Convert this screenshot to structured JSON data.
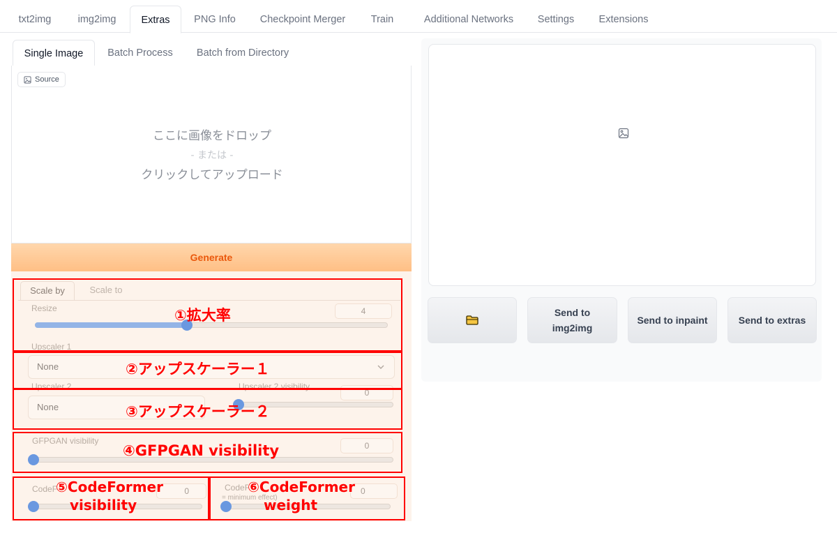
{
  "top_tabs": [
    "txt2img",
    "img2img",
    "Extras",
    "PNG Info",
    "Checkpoint Merger",
    "Train",
    "Additional Networks",
    "Settings",
    "Extensions"
  ],
  "sub_tabs": [
    "Single Image",
    "Batch Process",
    "Batch from Directory"
  ],
  "source_label": "Source",
  "dropzone": {
    "line1": "ここに画像をドロップ",
    "line2": "- または -",
    "line3": "クリックしてアップロード"
  },
  "generate_label": "Generate",
  "scale_tabs": [
    "Scale by",
    "Scale to"
  ],
  "resize": {
    "label": "Resize",
    "value": "4",
    "level": 0.43
  },
  "upscaler1": {
    "label": "Upscaler 1",
    "value": "None"
  },
  "upscaler2": {
    "label": "Upscaler 2",
    "value": "None"
  },
  "upscaler2_visibility": {
    "label": "Upscaler 2 visibility",
    "value": "0",
    "level": 0
  },
  "gfpgan": {
    "label": "GFPGAN visibility",
    "value": "0",
    "level": 0
  },
  "codeformer_visibility": {
    "label": "CodeFormer visibility",
    "value": "0",
    "level": 0
  },
  "codeformer_weight": {
    "label": "CodeFormer weight (0 = maximum effect, 1 = minimum effect)",
    "sub_label": "= minimum effect)",
    "value": "0",
    "level": 0
  },
  "annotations": {
    "a1": "①拡大率",
    "a2": "②アップスケーラー１",
    "a3": "③アップスケーラー２",
    "a4": "④GFPGAN visibility",
    "a5_line1": "⑤CodeFormer",
    "a5_line2": "visibility",
    "a6_line1": "⑥CodeFormer",
    "a6_line2": "weight"
  },
  "buttons": {
    "open_folder_icon": "folder-icon",
    "send_img2img": "Send to img2img",
    "send_inpaint": "Send to inpaint",
    "send_extras": "Send to extras"
  },
  "colors": {
    "accent": "#ea580c",
    "annotation": "#ff0000",
    "slider": "#6a98e0"
  }
}
